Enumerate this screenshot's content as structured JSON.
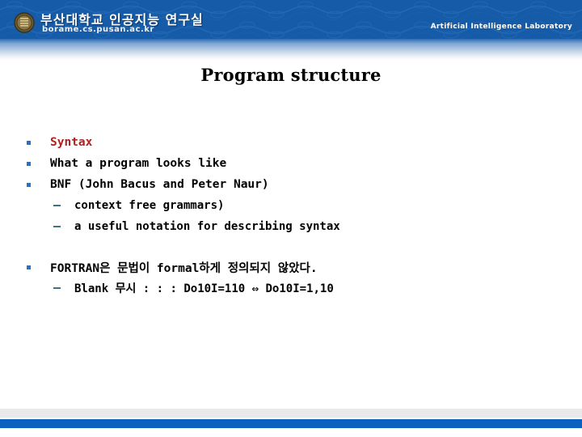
{
  "header": {
    "org_name_ko": "부산대학교 인공지능 연구실",
    "url": "borame.cs.pusan.ac.kr",
    "lab_name_en": "Artificial Intelligence Laboratory",
    "logo_icon": "university-seal-icon",
    "bg_color": "#155ba8"
  },
  "slide": {
    "title": "Program structure"
  },
  "content": {
    "items": [
      {
        "level": 1,
        "marker": "square",
        "text": "Syntax",
        "color": "#b02222"
      },
      {
        "level": 1,
        "marker": "square",
        "text": "What a program looks like",
        "color": "#000000"
      },
      {
        "level": 1,
        "marker": "square",
        "text": "BNF (John Bacus and Peter Naur)",
        "color": "#000000"
      },
      {
        "level": 2,
        "marker": "dash",
        "text": "context free grammars)",
        "color": "#000000"
      },
      {
        "level": 2,
        "marker": "dash",
        "text": "a useful notation for describing syntax",
        "color": "#000000"
      },
      {
        "level": 0,
        "marker": "none",
        "text": "",
        "color": "#000000"
      },
      {
        "level": 1,
        "marker": "square",
        "text": "FORTRAN은 문법이 formal하게 정의되지 않았다.",
        "color": "#000000"
      },
      {
        "level": 2,
        "marker": "dash",
        "text": "Blank 무시 : : : Do10I=110 ⇔ Do10I=1,10",
        "color": "#000000"
      }
    ]
  },
  "footer": {
    "gray_color": "#e9e9ea",
    "blue_color": "#0b61bd"
  }
}
